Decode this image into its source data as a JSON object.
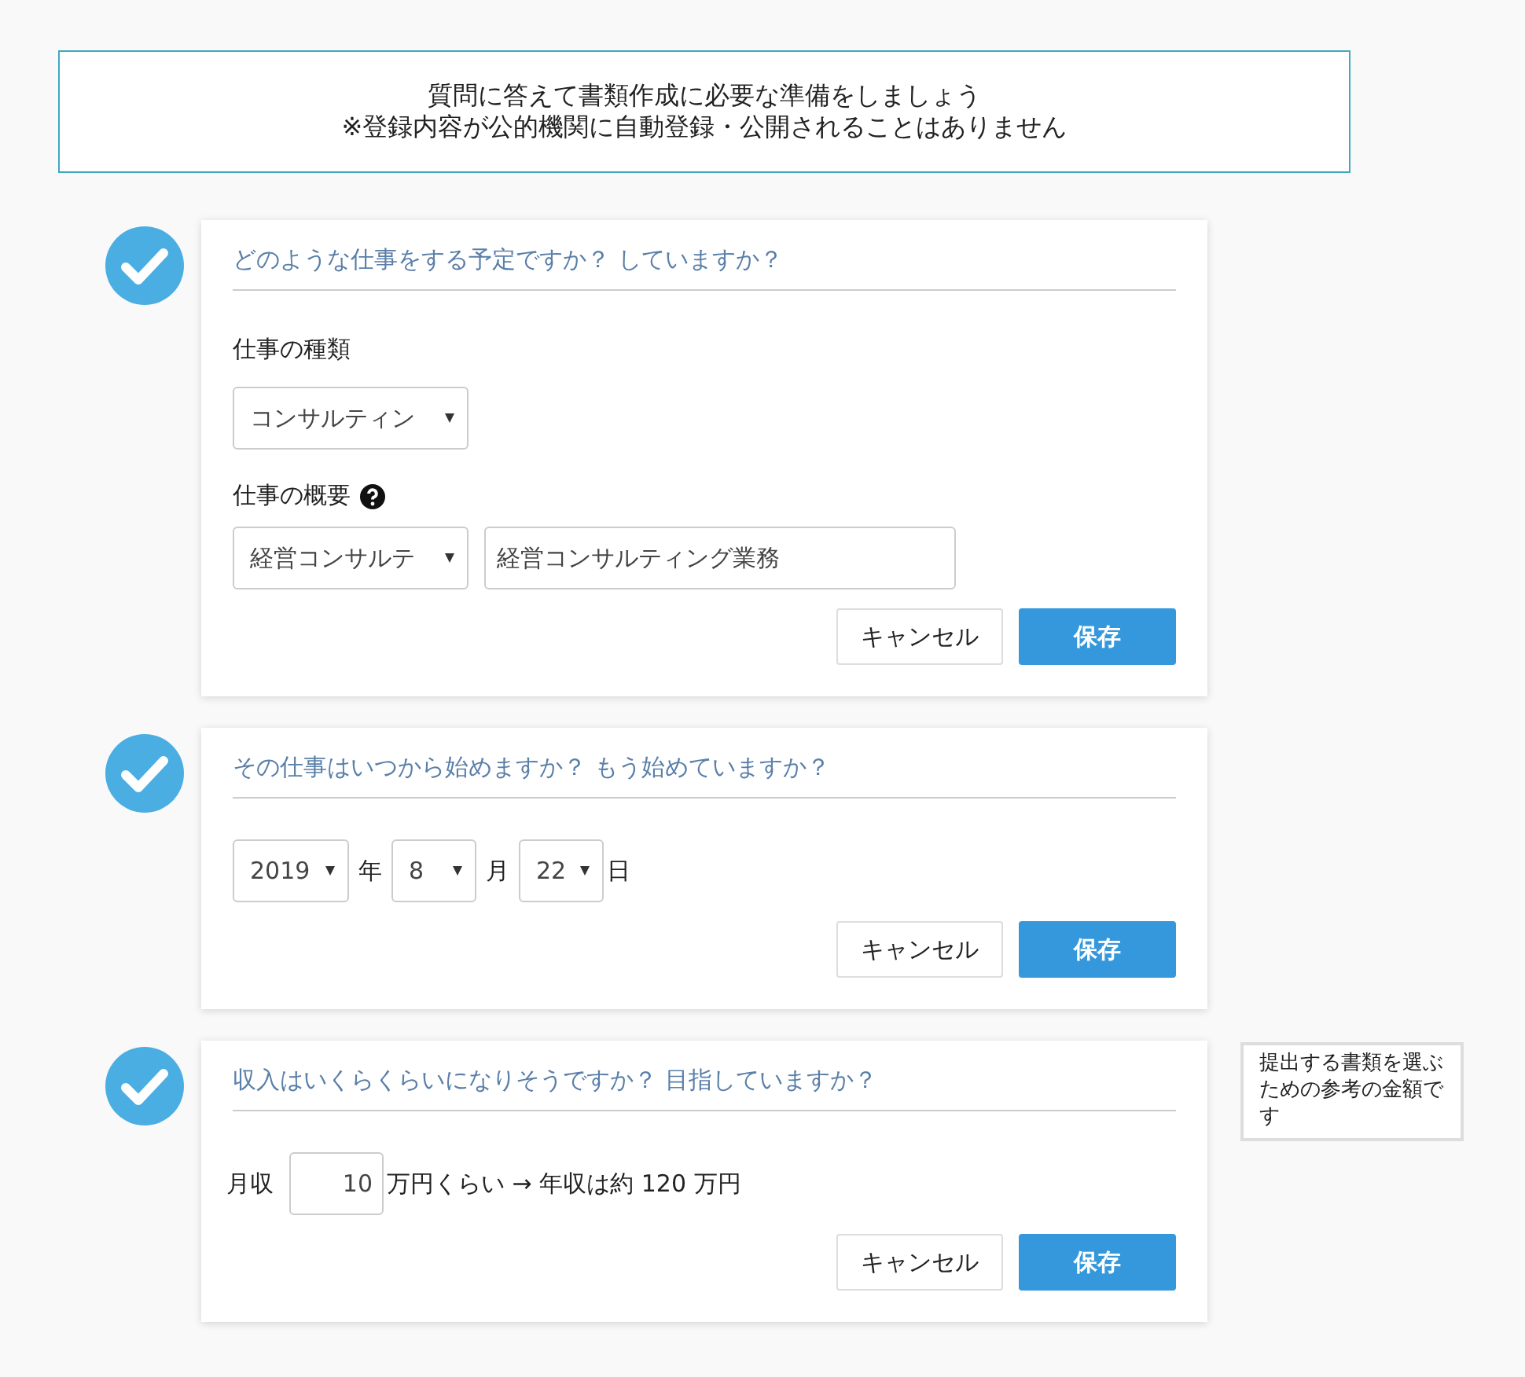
{
  "notice": {
    "lines": [
      "質問に答えて書類作成に必要な準備をしましょう",
      "※登録内容が公的機関に自動登録・公開されることはありません"
    ]
  },
  "sections": [
    {
      "kind": "job",
      "done": true,
      "question": "どのような仕事をする予定ですか？ していますか？",
      "type_label": "仕事の種類",
      "type_value": "コンサルティン",
      "summary_label": "仕事の概要",
      "summary_select": "経営コンサルテ",
      "summary_value": "経営コンサルティング業務",
      "cancel": "キャンセル",
      "save": "保存"
    },
    {
      "kind": "date",
      "done": true,
      "question": "その仕事はいつから始めますか？ もう始めていますか？",
      "year": "2019",
      "year_unit": "年",
      "month": "8",
      "month_unit": "月",
      "day": "22",
      "day_unit": "日",
      "cancel": "キャンセル",
      "save": "保存"
    },
    {
      "kind": "income",
      "done": true,
      "question": "収入はいくらくらいになりそうですか？ 目指していますか？",
      "prefix": "月収",
      "amount": "10",
      "result": "万円くらい → 年収は約 120 万円",
      "cancel": "キャンセル",
      "save": "保存",
      "tooltip": "提出する書類を選ぶための参考の金額です"
    }
  ]
}
